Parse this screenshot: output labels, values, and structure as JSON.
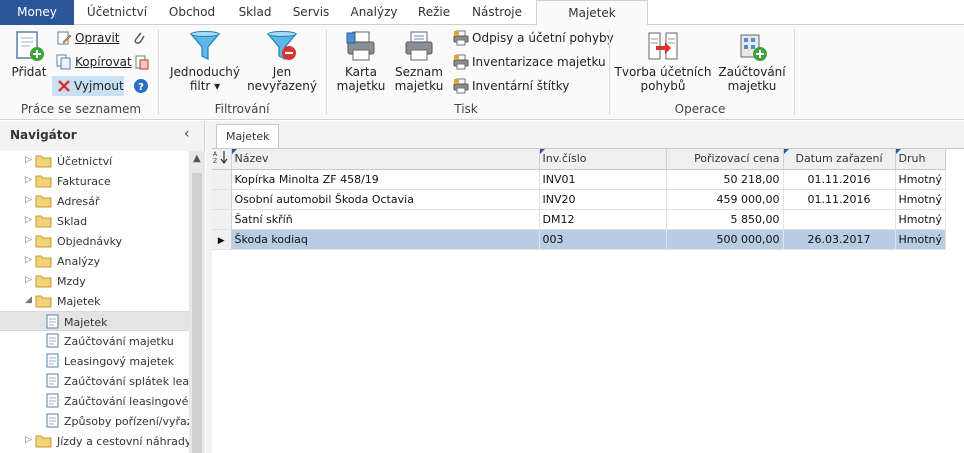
{
  "menu": {
    "tabs": [
      {
        "label": "Money"
      },
      {
        "label": "Účetnictví"
      },
      {
        "label": "Obchod"
      },
      {
        "label": "Sklad"
      },
      {
        "label": "Servis"
      },
      {
        "label": "Analýzy"
      },
      {
        "label": "Režie"
      },
      {
        "label": "Nástroje"
      },
      {
        "label": "Majetek"
      }
    ],
    "active": "Majetek",
    "brand_color": "#2b579a"
  },
  "ribbon": {
    "list_group": {
      "label": "Práce se seznamem",
      "add": "Přidat",
      "edit": "Opravit",
      "copy": "Kopírovat",
      "cut": "Vyjmout"
    },
    "filter_group": {
      "label": "Filtrování",
      "simple_filter_line1": "Jednoduchý",
      "simple_filter_line2": "filtr",
      "unsorted_line1": "Jen",
      "unsorted_line2": "nevyřazený"
    },
    "print_group": {
      "label": "Tisk",
      "card_line1": "Karta",
      "card_line2": "majetku",
      "list_line1": "Seznam",
      "list_line2": "majetku",
      "depreciation": "Odpisy a účetní pohyby",
      "inventory": "Inventarizace majetku",
      "labels": "Inventární štítky"
    },
    "ops_group": {
      "label": "Operace",
      "create_line1": "Tvorba účetních",
      "create_line2": "pohybů",
      "post_line1": "Zaúčtování",
      "post_line2": "majetku"
    }
  },
  "navigator": {
    "title": "Navigátor",
    "collapse_symbol": "‹",
    "items": [
      {
        "label": "Účetnictví",
        "type": "folder",
        "expanded": false
      },
      {
        "label": "Fakturace",
        "type": "folder",
        "expanded": false
      },
      {
        "label": "Adresář",
        "type": "folder",
        "expanded": false
      },
      {
        "label": "Sklad",
        "type": "folder",
        "expanded": false
      },
      {
        "label": "Objednávky",
        "type": "folder",
        "expanded": false
      },
      {
        "label": "Analýzy",
        "type": "folder",
        "expanded": false
      },
      {
        "label": "Mzdy",
        "type": "folder",
        "expanded": false
      },
      {
        "label": "Majetek",
        "type": "folder",
        "expanded": true
      },
      {
        "label": "Majetek",
        "type": "doc",
        "selected": true
      },
      {
        "label": "Zaúčtování majetku",
        "type": "doc"
      },
      {
        "label": "Leasingový majetek",
        "type": "doc"
      },
      {
        "label": "Zaúčtování splátek leasing",
        "type": "doc"
      },
      {
        "label": "Zaúčtování leasingového i",
        "type": "doc"
      },
      {
        "label": "Způsoby pořízení/vyřazen",
        "type": "doc"
      },
      {
        "label": "Jízdy a cestovní náhrady",
        "type": "folder",
        "expanded": false
      }
    ]
  },
  "content": {
    "tab_label": "Majetek",
    "sort_icon_label": "AZ",
    "columns": [
      "Název",
      "Inv.číslo",
      "Pořizovací cena",
      "Datum zařazení",
      "Druh"
    ],
    "rows": [
      {
        "name": "Kopírka Minolta ZF 458/19",
        "inv": "INV01",
        "price": "50 218,00",
        "date": "01.11.2016",
        "kind": "Hmotný",
        "selected": false
      },
      {
        "name": "Osobní automobil Škoda Octavia",
        "inv": "INV20",
        "price": "459 000,00",
        "date": "01.11.2016",
        "kind": "Hmotný",
        "selected": false
      },
      {
        "name": "Šatní skříň",
        "inv": "DM12",
        "price": "5 850,00",
        "date": "",
        "kind": "Hmotný",
        "selected": false
      },
      {
        "name": "Škoda kodiaq",
        "inv": "003",
        "price": "500 000,00",
        "date": "26.03.2017",
        "kind": "Hmotný",
        "selected": true
      }
    ],
    "selected_row_color": "#b8cce4",
    "row_marker": "▶"
  }
}
